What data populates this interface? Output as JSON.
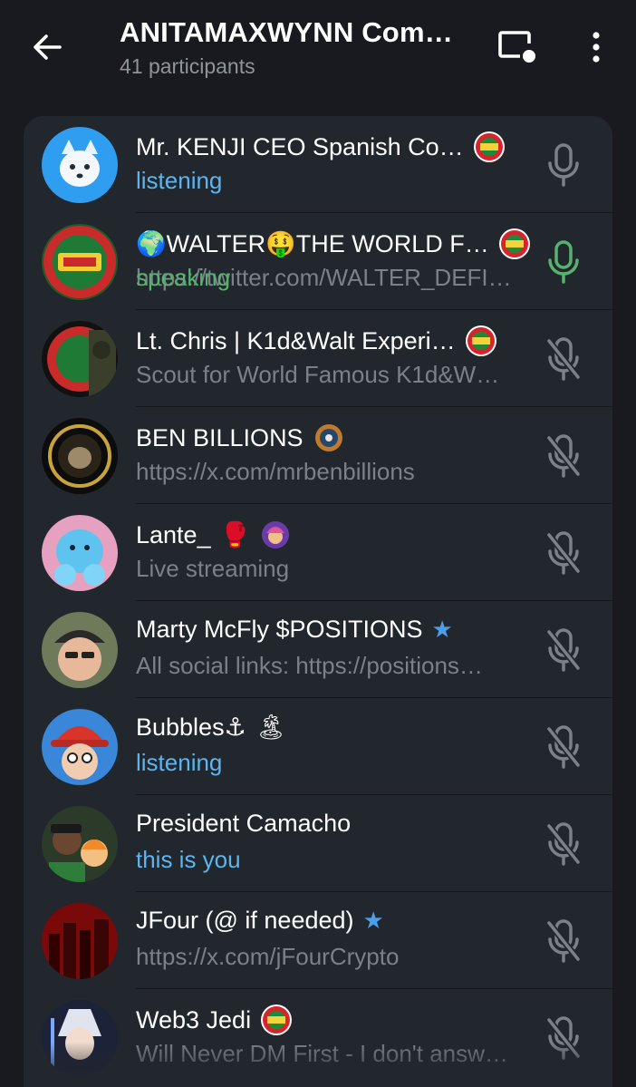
{
  "header": {
    "title": "ANITAMAXWYNN Com…",
    "subtitle": "41 participants"
  },
  "colors": {
    "background": "#181a1f",
    "panel": "#22262d",
    "listening": "#5bb5f0",
    "speaking": "#57b26f",
    "muted": "#7b8089"
  },
  "participants": [
    {
      "name": "Mr. KENJI CEO Spanish Co…",
      "status": "listening",
      "status_style": "blue",
      "mic": "mic-icon"
    },
    {
      "name": "WALTER",
      "name_mid": "THE WORLD F…",
      "status": "speaking",
      "status_under": "https://twitter.com/WALTER_DEFI…",
      "status_style": "speaking",
      "mic": "mic-active-icon"
    },
    {
      "name": "Lt. Chris | K1d&Walt Experi…",
      "status": "Scout for World Famous K1d&W…",
      "status_style": "gray",
      "mic": "mic-muted-icon"
    },
    {
      "name": "BEN BILLIONS",
      "status": "https://x.com/mrbenbillions",
      "status_style": "gray",
      "mic": "mic-muted-icon"
    },
    {
      "name": "Lante_",
      "status": "Live streaming",
      "status_style": "gray",
      "mic": "mic-muted-icon"
    },
    {
      "name": "Marty McFly $POSITIONS",
      "status": "All social links: https://positions…",
      "status_style": "gray",
      "mic": "mic-muted-icon"
    },
    {
      "name": "Bubbles⚓",
      "status": "listening",
      "status_style": "blue",
      "mic": "mic-muted-icon"
    },
    {
      "name": "President Camacho",
      "status": "this is you",
      "status_style": "blue",
      "mic": "mic-muted-icon"
    },
    {
      "name": "JFour (@ if needed)",
      "status": "https://x.com/jFourCrypto",
      "status_style": "gray",
      "mic": "mic-muted-icon"
    },
    {
      "name": "Web3 Jedi",
      "status": "Will Never DM First - I don't answ…",
      "status_style": "gray",
      "mic": "mic-muted-icon"
    }
  ]
}
